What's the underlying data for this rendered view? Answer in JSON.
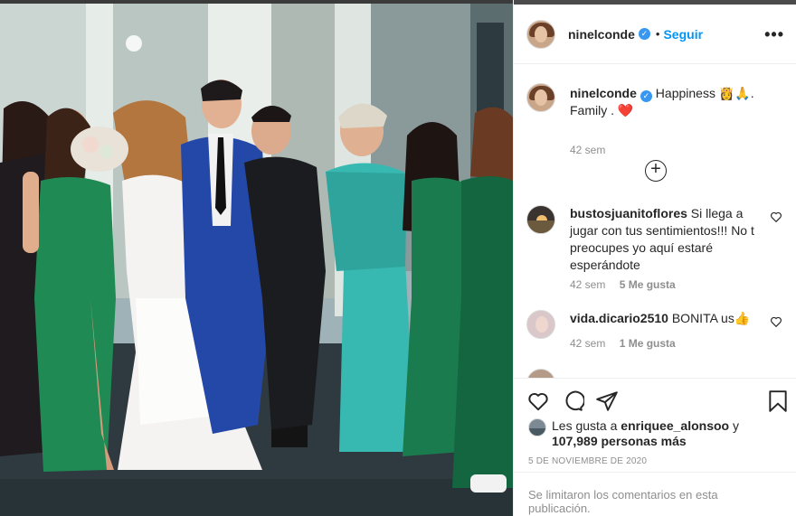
{
  "post": {
    "username": "ninelconde",
    "follow_label": "Seguir",
    "more_label": "•••",
    "caption": {
      "username": "ninelconde",
      "text": "Happiness 👸🙏. Family . ❤️",
      "time": "42 sem"
    },
    "load_more_label": "+",
    "comments": [
      {
        "username": "bustosjuanitoflores",
        "text": "Si llega a jugar con tus sentimientos!!! No t preocupes yo aquí estaré esperándote",
        "time": "42 sem",
        "likes": "5 Me gusta"
      },
      {
        "username": "vida.dicario2510",
        "text": "BONITA us👍",
        "time": "42 sem",
        "likes": "1 Me gusta"
      }
    ],
    "liked_by_prefix": "Les gusta a",
    "liked_by_user": "enriquee_alonsoo",
    "liked_by_joiner": "y",
    "liked_by_count": "107,989 personas más",
    "date": "5 DE NOVIEMBRE DE 2020",
    "comments_disabled": "Se limitaron los comentarios en esta publicación."
  },
  "icons": {
    "verified": "verified-badge-icon",
    "like": "heart-icon",
    "comment": "comment-icon",
    "share": "paper-plane-icon",
    "save": "bookmark-icon",
    "more": "more-options-icon",
    "add": "plus-circle-icon"
  },
  "colors": {
    "accent": "#0095f6",
    "verified": "#3897f0",
    "muted": "#8e8e8e",
    "like_heart": "#ed4956"
  }
}
